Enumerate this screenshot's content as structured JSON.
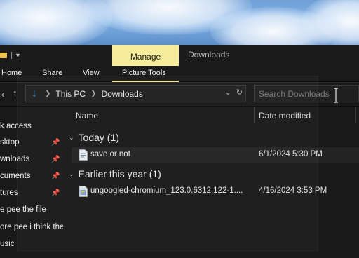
{
  "ribbon": {
    "contextual_tab": "Manage",
    "window_title": "Downloads",
    "tabs": [
      "Home",
      "Share",
      "View",
      "Picture Tools"
    ]
  },
  "address": {
    "crumbs": [
      "This PC",
      "Downloads"
    ]
  },
  "search": {
    "placeholder": "Search Downloads"
  },
  "sidebar": {
    "items": [
      {
        "label": "k access",
        "pinned": false
      },
      {
        "label": "sktop",
        "pinned": true
      },
      {
        "label": "wnloads",
        "pinned": true
      },
      {
        "label": "cuments",
        "pinned": true
      },
      {
        "label": "tures",
        "pinned": true
      },
      {
        "label": "e pee the file",
        "pinned": false
      },
      {
        "label": "ore pee i think the",
        "pinned": false
      },
      {
        "label": "usic",
        "pinned": false
      }
    ]
  },
  "columns": {
    "name": "Name",
    "date_modified": "Date modified"
  },
  "groups": [
    {
      "title": "Today (1)",
      "files": [
        {
          "name": "save or not",
          "date": "6/1/2024 5:30 PM"
        }
      ]
    },
    {
      "title": "Earlier this year (1)",
      "files": [
        {
          "name": "ungoogled-chromium_123.0.6312.122-1....",
          "date": "4/16/2024 3:53 PM"
        }
      ]
    }
  ],
  "colors": {
    "background": "#191919",
    "ribbon_accent": "#f6ec9b",
    "nav_blue": "#3b8de0"
  }
}
